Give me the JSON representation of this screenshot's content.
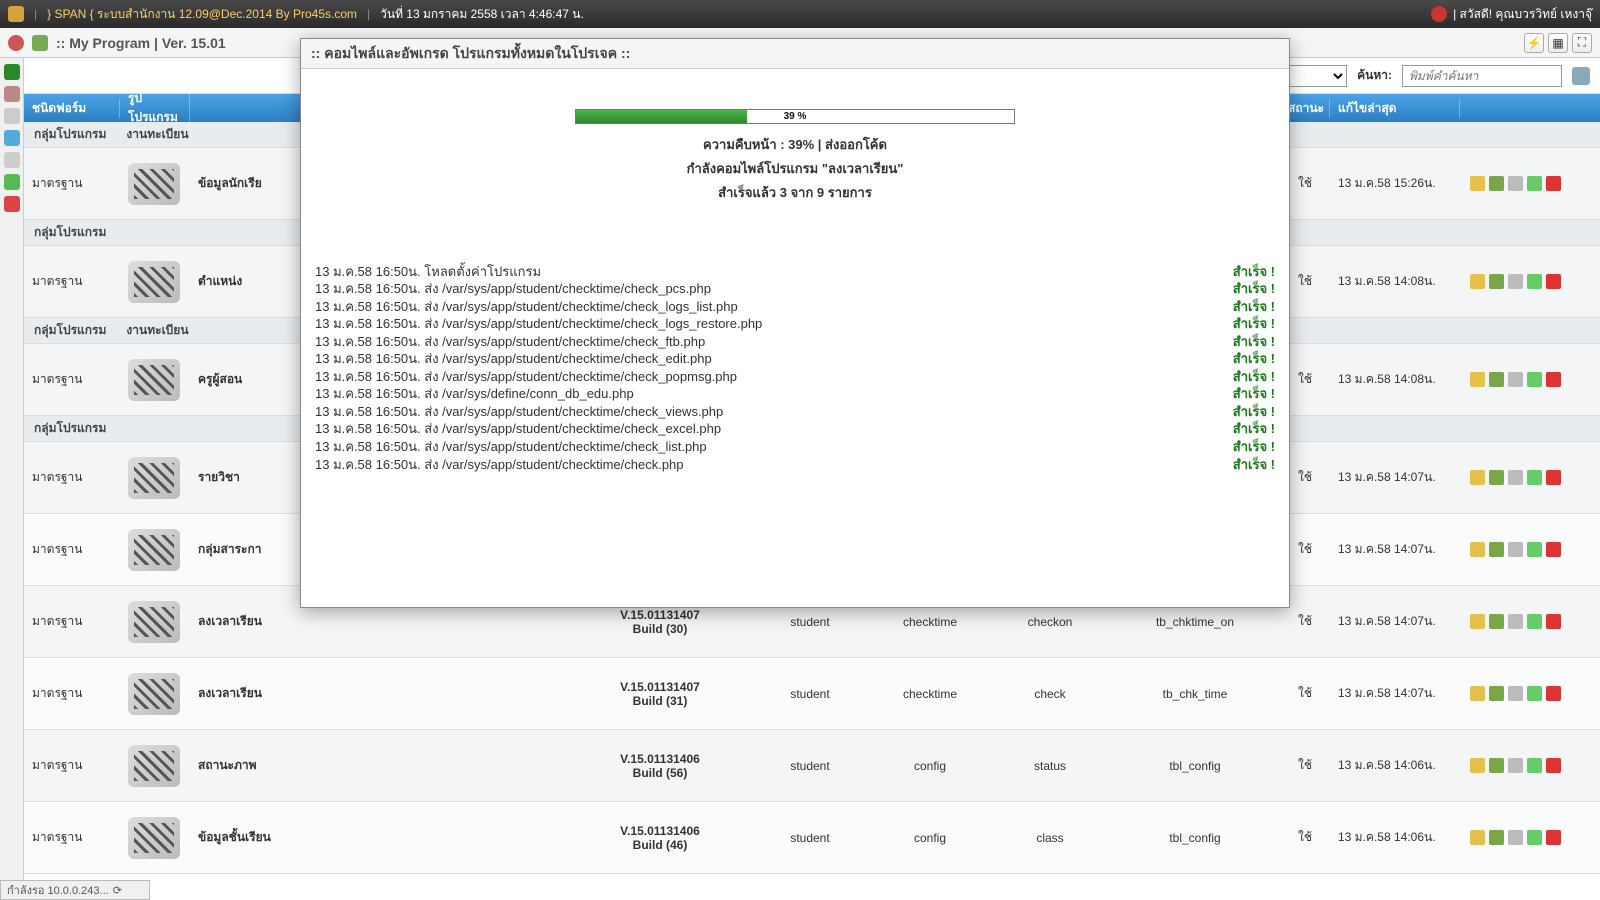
{
  "topbar": {
    "app_title": "} SPAN { ระบบสำนักงาน 12.09@Dec.2014 By Pro45s.com",
    "date_label": "วันที่ 13 มกราคม 2558 เวลา 4:46:47 น.",
    "welcome": "| สวัสดี! คุณบวรวิทย์ เหงาจุ๊"
  },
  "secbar": {
    "title": ":: My Program  |  Ver. 15.01"
  },
  "subhdr": {
    "search_label": "ค้นหา:",
    "search_placeholder": "พิมพ์คำค้นหา"
  },
  "columns": {
    "type": "ชนิดฟอร์ม",
    "img": "รูปโปรแกรม",
    "name": "",
    "ver": "",
    "m1": "",
    "m2": "",
    "m3": "",
    "tbl": "",
    "stat": "สถานะ",
    "date": "แก้ไขล่าสุด",
    "act": ""
  },
  "groups": [
    {
      "g": "กลุ่มโปรแกรม",
      "s": "งานทะเบียน"
    },
    {
      "g": "กลุ่มโปรแกรม",
      "s": ""
    },
    {
      "g": "กลุ่มโปรแกรม",
      "s": "งานทะเบียน"
    },
    {
      "g": "กลุ่มโปรแกรม",
      "s": ""
    }
  ],
  "rows": [
    {
      "type": "มาตรฐาน",
      "name": "ข้อมูลนักเรีย",
      "ver": "",
      "m1": "",
      "m2": "",
      "m3": "",
      "tbl": "",
      "stat": "ใช้",
      "date": "13 ม.ค.58 15:26น."
    },
    {
      "type": "มาตรฐาน",
      "name": "ตำแหน่ง",
      "ver": "",
      "m1": "",
      "m2": "",
      "m3": "",
      "tbl": "",
      "stat": "ใช้",
      "date": "13 ม.ค.58 14:08น."
    },
    {
      "type": "มาตรฐาน",
      "name": "ครูผู้สอน",
      "ver": "",
      "m1": "",
      "m2": "",
      "m3": "",
      "tbl": "",
      "stat": "ใช้",
      "date": "13 ม.ค.58 14:08น."
    },
    {
      "type": "มาตรฐาน",
      "name": "รายวิชา",
      "ver": "",
      "m1": "",
      "m2": "",
      "m3": "",
      "tbl": "",
      "stat": "ใช้",
      "date": "13 ม.ค.58 14:07น."
    },
    {
      "type": "มาตรฐาน",
      "name": "กลุ่มสาระกา",
      "ver": "",
      "m1": "",
      "m2": "",
      "m3": "",
      "tbl": "",
      "stat": "ใช้",
      "date": "13 ม.ค.58 14:07น."
    },
    {
      "type": "มาตรฐาน",
      "name": "ลงเวลาเรียน",
      "ver": "V.15.01131407\nBuild (30)",
      "m1": "student",
      "m2": "checktime",
      "m3": "checkon",
      "tbl": "tb_chktime_on",
      "stat": "ใช้",
      "date": "13 ม.ค.58 14:07น."
    },
    {
      "type": "มาตรฐาน",
      "name": "ลงเวลาเรียน",
      "ver": "V.15.01131407\nBuild (31)",
      "m1": "student",
      "m2": "checktime",
      "m3": "check",
      "tbl": "tb_chk_time",
      "stat": "ใช้",
      "date": "13 ม.ค.58 14:07น."
    },
    {
      "type": "มาตรฐาน",
      "name": "สถานะภาพ",
      "ver": "V.15.01131406\nBuild (56)",
      "m1": "student",
      "m2": "config",
      "m3": "status",
      "tbl": "tbl_config",
      "stat": "ใช้",
      "date": "13 ม.ค.58 14:06น."
    },
    {
      "type": "มาตรฐาน",
      "name": "ข้อมูลชั้นเรียน",
      "ver": "V.15.01131406\nBuild (46)",
      "m1": "student",
      "m2": "config",
      "m3": "class",
      "tbl": "tbl_config",
      "stat": "ใช้",
      "date": "13 ม.ค.58 14:06น."
    }
  ],
  "modal": {
    "title": ":: คอมไพล์และอัพเกรด โปรแกรมทั้งหมดในโปรเจค ::",
    "percent": 39,
    "percent_label": "39 %",
    "line1": "ความคืบหน้า : 39%  |  ส่งออกโค้ด",
    "line2": "กำลังคอมไพล์โปรแกรม \"ลงเวลาเรียน\"",
    "line3": "สำเร็จแล้ว 3 จาก 9 รายการ",
    "ok_label": "สำเร็จ !",
    "log": [
      "13 ม.ค.58 16:50น. โหลดตั้งค่าโปรแกรม",
      "13 ม.ค.58 16:50น. ส่ง /var/sys/app/student/checktime/check_pcs.php",
      "13 ม.ค.58 16:50น. ส่ง /var/sys/app/student/checktime/check_logs_list.php",
      "13 ม.ค.58 16:50น. ส่ง /var/sys/app/student/checktime/check_logs_restore.php",
      "13 ม.ค.58 16:50น. ส่ง /var/sys/app/student/checktime/check_ftb.php",
      "13 ม.ค.58 16:50น. ส่ง /var/sys/app/student/checktime/check_edit.php",
      "13 ม.ค.58 16:50น. ส่ง /var/sys/app/student/checktime/check_popmsg.php",
      "13 ม.ค.58 16:50น. ส่ง /var/sys/define/conn_db_edu.php",
      "13 ม.ค.58 16:50น. ส่ง /var/sys/app/student/checktime/check_views.php",
      "13 ม.ค.58 16:50น. ส่ง /var/sys/app/student/checktime/check_excel.php",
      "13 ม.ค.58 16:50น. ส่ง /var/sys/app/student/checktime/check_list.php",
      "13 ม.ค.58 16:50น. ส่ง /var/sys/app/student/checktime/check.php"
    ]
  },
  "statusbar": {
    "text": "กำลังรอ 10.0.0.243..."
  }
}
